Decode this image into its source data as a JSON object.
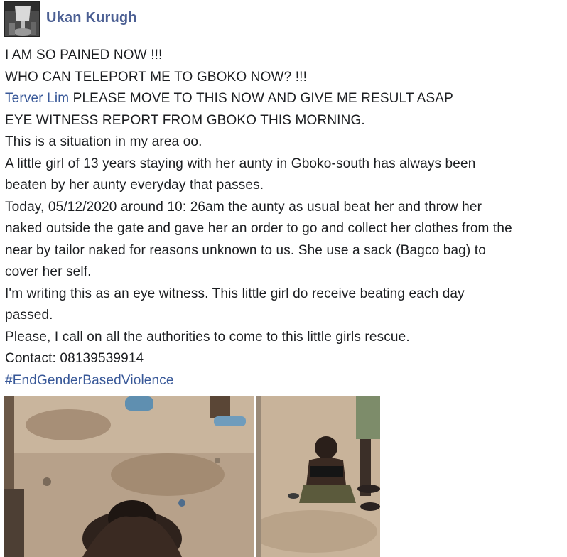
{
  "post": {
    "author": "Ukan Kurugh",
    "lines": [
      "I AM SO PAINED NOW !!!",
      "WHO CAN TELEPORT ME TO GBOKO NOW? !!!"
    ],
    "mention_name": "Terver Lim",
    "mention_rest": " PLEASE MOVE TO THIS NOW AND GIVE ME RESULT ASAP",
    "body_lines": [
      "EYE WITNESS REPORT FROM GBOKO THIS MORNING.",
      "This is a situation in my area oo.",
      "A little girl of 13 years staying with her aunty in Gboko-south has always been",
      "beaten by her aunty everyday that passes.",
      "Today, 05/12/2020 around 10: 26am the aunty as usual beat her and throw her",
      "naked outside the gate and gave her an order to go and collect her clothes from the",
      "near by tailor naked for reasons unknown to us. She use a sack (Bagco bag) to",
      "cover her self.",
      "I'm writing this as an eye witness. This little girl do receive beating each day",
      "passed.",
      "Please, I call on all the authorities to come to this little girls rescue.",
      "Contact: 08139539914"
    ],
    "hashtag": "#EndGenderBasedViolence"
  },
  "photos": [
    {
      "icon": "photo-left"
    },
    {
      "icon": "photo-right"
    }
  ]
}
